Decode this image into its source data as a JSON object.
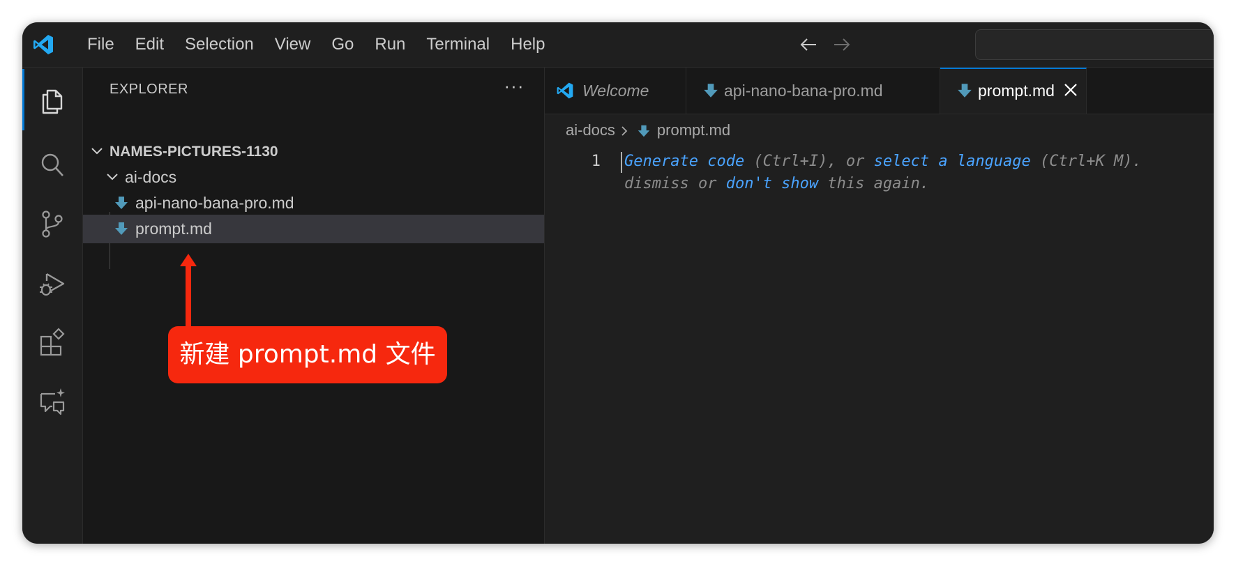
{
  "menu": {
    "items": [
      "File",
      "Edit",
      "Selection",
      "View",
      "Go",
      "Run",
      "Terminal",
      "Help"
    ]
  },
  "titlebar": {
    "logo": "vscode-logo",
    "back_icon": "arrow-left-icon",
    "forward_icon": "arrow-right-icon",
    "search_placeholder": ""
  },
  "activitybar": {
    "items": [
      "explorer-icon",
      "search-icon",
      "source-control-icon",
      "run-debug-icon",
      "extensions-icon",
      "chat-icon"
    ]
  },
  "sidebar": {
    "title": "EXPLORER",
    "more": "···",
    "root_folder": "NAMES-PICTURES-1130",
    "folder": "ai-docs",
    "files": [
      "api-nano-bana-pro.md",
      "prompt.md"
    ],
    "selected_file": "prompt.md"
  },
  "annotation": {
    "text": "新建 prompt.md 文件",
    "color": "#f6280e"
  },
  "tabs": [
    {
      "label": "Welcome",
      "icon": "vscode-logo",
      "active": false
    },
    {
      "label": "api-nano-bana-pro.md",
      "icon": "markdown-download-icon",
      "active": false
    },
    {
      "label": "prompt.md",
      "icon": "markdown-download-icon",
      "active": true
    }
  ],
  "breadcrumb": {
    "folder": "ai-docs",
    "file": "prompt.md"
  },
  "editor": {
    "line_number": "1",
    "hint": {
      "link1": "Generate code",
      "text1": " (Ctrl+I), or ",
      "link2": "select a language",
      "text2": " (Ctrl+K M).",
      "text3": "dismiss or ",
      "link3": "don't show",
      "text4": " this again."
    }
  },
  "colors": {
    "accent": "#0078d4",
    "link": "#4aa3ff",
    "file_icon": "#519aba"
  }
}
